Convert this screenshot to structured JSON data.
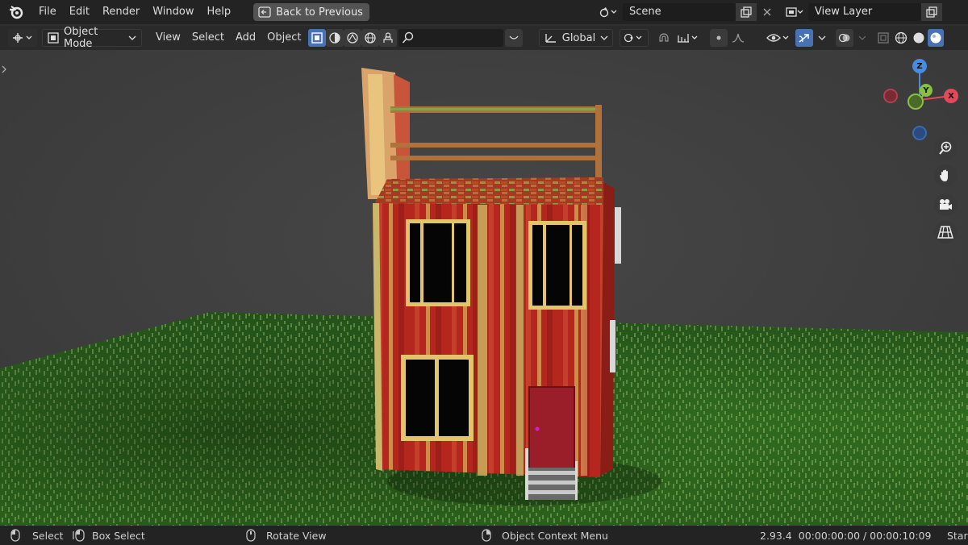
{
  "topbar": {
    "menus": [
      "File",
      "Edit",
      "Render",
      "Window",
      "Help"
    ],
    "back_label": "Back to Previous",
    "scene_name": "Scene",
    "view_layer_name": "View Layer"
  },
  "header": {
    "mode": "Object Mode",
    "menus": [
      "View",
      "Select",
      "Add",
      "Object"
    ],
    "transform_orientation": "Global",
    "search_placeholder": ""
  },
  "gizmo": {
    "z": "Z",
    "y": "Y",
    "x": "X"
  },
  "statusbar": {
    "select": "Select",
    "box_select": "Box Select",
    "rotate_view": "Rotate View",
    "context_menu": "Object Context Menu",
    "version": "2.93.4",
    "timecode": "00:00:00:00 / 00:00:10:09",
    "truncated": "Star"
  },
  "colors": {
    "accent": "#4772b3",
    "grass": "#2f6a1e",
    "house_red": "#b5271e",
    "house_stripe": "#c8b86a"
  }
}
